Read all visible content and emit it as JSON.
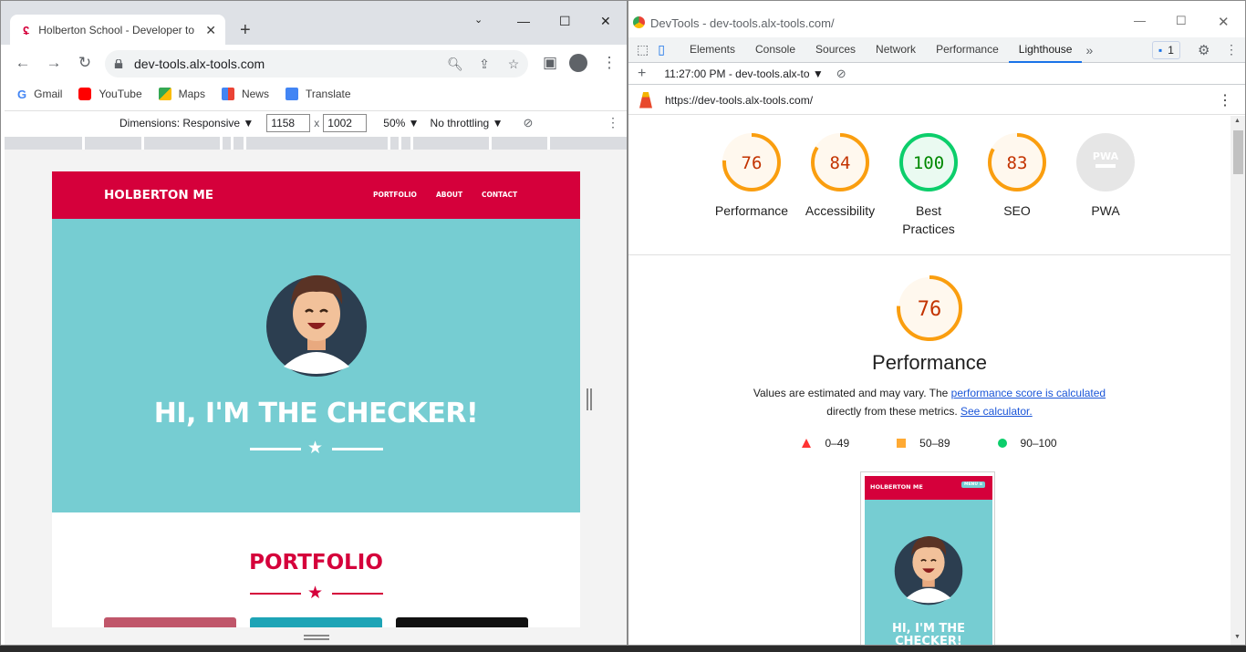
{
  "browser": {
    "tab_title": "Holberton School - Developer to",
    "omnibox_url": "dev-tools.alx-tools.com",
    "bookmarks": [
      "Gmail",
      "YouTube",
      "Maps",
      "News",
      "Translate"
    ],
    "device_toolbar": {
      "dimensions_label": "Dimensions: Responsive",
      "width": "1158",
      "times": "x",
      "height": "1002",
      "zoom": "50%",
      "throttling": "No throttling"
    }
  },
  "site": {
    "brand": "HOLBERTON ME",
    "nav": [
      "PORTFOLIO",
      "ABOUT",
      "CONTACT"
    ],
    "hero_title": "HI, I'M THE CHECKER!",
    "portfolio_title": "PORTFOLIO"
  },
  "devtools": {
    "window_title": "DevTools - dev-tools.alx-tools.com/",
    "tabs": [
      "Elements",
      "Console",
      "Sources",
      "Network",
      "Performance",
      "Lighthouse"
    ],
    "issues_count": "1",
    "run_label": "11:27:00 PM - dev-tools.alx-to",
    "report_url": "https://dev-tools.alx-tools.com/",
    "scores": [
      {
        "label": "Performance",
        "score": 76,
        "color": "#fa9e0f"
      },
      {
        "label": "Accessibility",
        "score": 84,
        "color": "#fa9e0f"
      },
      {
        "label": "Best Practices",
        "score": 100,
        "color": "#0cce6b"
      },
      {
        "label": "SEO",
        "score": 83,
        "color": "#fa9e0f"
      },
      {
        "label": "PWA",
        "score": null,
        "color": "#cccccc"
      }
    ],
    "pwa_badge": "PWA",
    "performance": {
      "score": "76",
      "title": "Performance",
      "desc_prefix": "Values are estimated and may vary. The ",
      "desc_link1": "performance score is calculated",
      "desc_mid": "directly from these metrics. ",
      "desc_link2": "See calculator."
    },
    "legend": [
      "0–49",
      "50–89",
      "90–100"
    ],
    "thumbnail": {
      "brand": "HOLBERTON ME",
      "menu": "MENU ≡",
      "hero_line1": "HI, I'M THE",
      "hero_line2": "CHECKER!"
    }
  }
}
